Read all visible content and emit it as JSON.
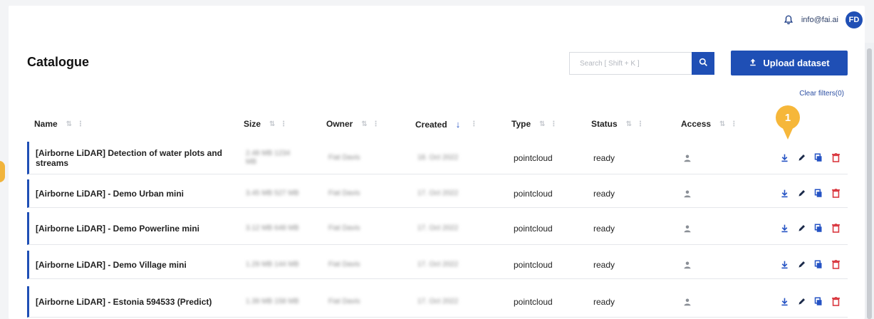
{
  "header": {
    "email": "info@fai.ai",
    "avatar_initials": "FD"
  },
  "page": {
    "title": "Catalogue"
  },
  "search": {
    "placeholder": "Search [ Shift + K ]"
  },
  "actions": {
    "upload_label": "Upload dataset",
    "clear_filters": "Clear filters(0)"
  },
  "callout": {
    "number": "1"
  },
  "columns": [
    "Name",
    "Size",
    "Owner",
    "Created",
    "Type",
    "Status",
    "Access"
  ],
  "rows": [
    {
      "name": "[Airborne LiDAR] Detection of water plots and streams",
      "size": "2.48 MB 1234 MB",
      "owner": "Fiat Davis",
      "created": "18. Oct 2022",
      "type": "pointcloud",
      "status": "ready"
    },
    {
      "name": "[Airborne LiDAR] - Demo Urban mini",
      "size": "3.45 MB 527 MB",
      "owner": "Fiat Davis",
      "created": "17. Oct 2022",
      "type": "pointcloud",
      "status": "ready"
    },
    {
      "name": "[Airborne LiDAR] - Demo Powerline mini",
      "size": "3.12 MB 648 MB",
      "owner": "Fiat Davis",
      "created": "17. Oct 2022",
      "type": "pointcloud",
      "status": "ready"
    },
    {
      "name": "[Airborne LiDAR] - Demo Village mini",
      "size": "1.29 MB 144 MB",
      "owner": "Fiat Davis",
      "created": "17. Oct 2022",
      "type": "pointcloud",
      "status": "ready"
    },
    {
      "name": "[Airborne LiDAR] - Estonia 594533 (Predict)",
      "size": "1.39 MB 158 MB",
      "owner": "Fiat Davis",
      "created": "17. Oct 2022",
      "type": "pointcloud",
      "status": "ready"
    }
  ],
  "colors": {
    "accent": "#1f4fb5",
    "callout": "#f6b73a",
    "delete": "#d9363e"
  }
}
